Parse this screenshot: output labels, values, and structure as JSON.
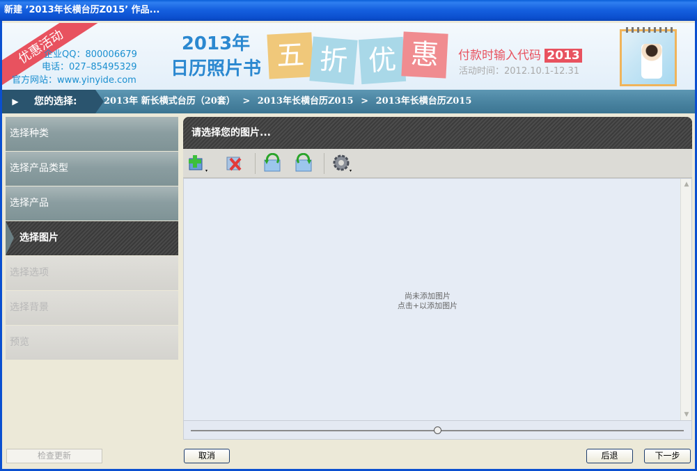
{
  "window": {
    "title": "新建 ’2013年长横台历Z015’ 作品..."
  },
  "banner": {
    "ribbon": "优惠活动",
    "qq": "企业QQ：800006679",
    "phone": "电话：027–85495329",
    "website": "官方网站：www.yinyide.com",
    "promo_title": "2013年",
    "promo_subtitle": "日历照片书",
    "big_chars": [
      "五",
      "折",
      "优",
      "惠"
    ],
    "code_label": "付款时输入代码",
    "code_value": "2013",
    "period": "活动时间：2012.10.1-12.31"
  },
  "breadcrumb": {
    "label": "您的选择:",
    "items": [
      "2013年 新长横式台历（20套）",
      ">",
      "2013年长横台历Z015",
      ">",
      "2013年长横台历Z015"
    ]
  },
  "steps": [
    {
      "label": "选择种类",
      "state": "done"
    },
    {
      "label": "选择产品类型",
      "state": "done"
    },
    {
      "label": "选择产品",
      "state": "done"
    },
    {
      "label": "选择图片",
      "state": "active"
    },
    {
      "label": "选择选项",
      "state": "todo"
    },
    {
      "label": "选择背景",
      "state": "todo"
    },
    {
      "label": "预览",
      "state": "todo"
    }
  ],
  "panel": {
    "title": "请选择您的图片...",
    "empty_line1": "尚未添加图片",
    "empty_line2": "点击+以添加图片"
  },
  "buttons": {
    "check_update": "检查更新",
    "cancel": "取消",
    "back": "后退",
    "next": "下一步"
  },
  "colors": {
    "titlebar": "#0b4fcf",
    "breadcrumb": "#4a84a1",
    "accent_red": "#e8525f",
    "banner_blue": "#2b88d0"
  }
}
